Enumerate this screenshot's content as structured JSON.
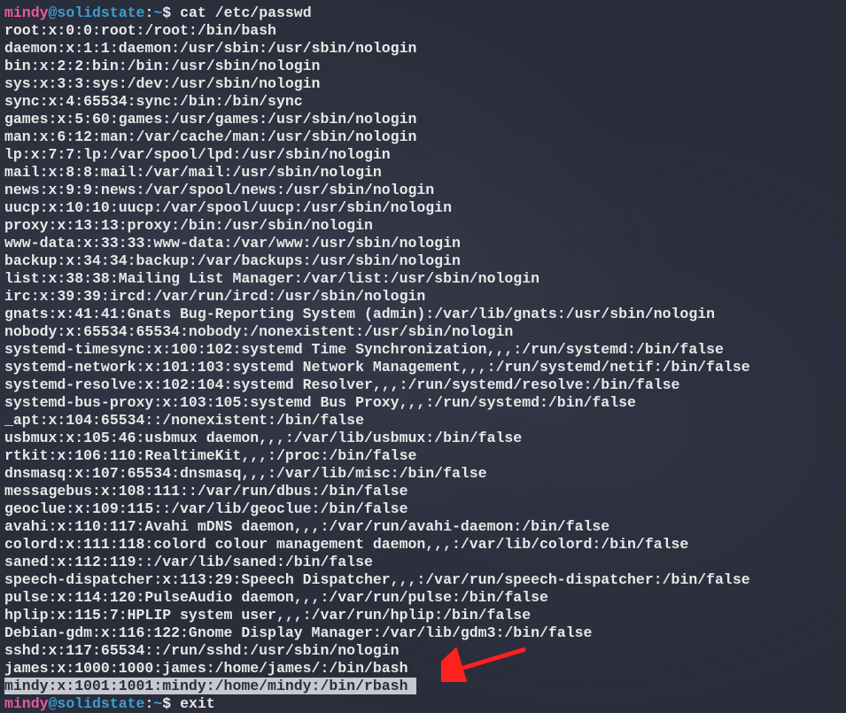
{
  "prompt1": {
    "user": "mindy",
    "at": "@",
    "host": "solidstate",
    "colon": ":",
    "path": "~",
    "dollar": "$ ",
    "command": "cat /etc/passwd"
  },
  "output": {
    "lines": [
      "root:x:0:0:root:/root:/bin/bash",
      "daemon:x:1:1:daemon:/usr/sbin:/usr/sbin/nologin",
      "bin:x:2:2:bin:/bin:/usr/sbin/nologin",
      "sys:x:3:3:sys:/dev:/usr/sbin/nologin",
      "sync:x:4:65534:sync:/bin:/bin/sync",
      "games:x:5:60:games:/usr/games:/usr/sbin/nologin",
      "man:x:6:12:man:/var/cache/man:/usr/sbin/nologin",
      "lp:x:7:7:lp:/var/spool/lpd:/usr/sbin/nologin",
      "mail:x:8:8:mail:/var/mail:/usr/sbin/nologin",
      "news:x:9:9:news:/var/spool/news:/usr/sbin/nologin",
      "uucp:x:10:10:uucp:/var/spool/uucp:/usr/sbin/nologin",
      "proxy:x:13:13:proxy:/bin:/usr/sbin/nologin",
      "www-data:x:33:33:www-data:/var/www:/usr/sbin/nologin",
      "backup:x:34:34:backup:/var/backups:/usr/sbin/nologin",
      "list:x:38:38:Mailing List Manager:/var/list:/usr/sbin/nologin",
      "irc:x:39:39:ircd:/var/run/ircd:/usr/sbin/nologin",
      "gnats:x:41:41:Gnats Bug-Reporting System (admin):/var/lib/gnats:/usr/sbin/nologin",
      "nobody:x:65534:65534:nobody:/nonexistent:/usr/sbin/nologin",
      "systemd-timesync:x:100:102:systemd Time Synchronization,,,:/run/systemd:/bin/false",
      "systemd-network:x:101:103:systemd Network Management,,,:/run/systemd/netif:/bin/false",
      "systemd-resolve:x:102:104:systemd Resolver,,,:/run/systemd/resolve:/bin/false",
      "systemd-bus-proxy:x:103:105:systemd Bus Proxy,,,:/run/systemd:/bin/false",
      "_apt:x:104:65534::/nonexistent:/bin/false",
      "usbmux:x:105:46:usbmux daemon,,,:/var/lib/usbmux:/bin/false",
      "rtkit:x:106:110:RealtimeKit,,,:/proc:/bin/false",
      "dnsmasq:x:107:65534:dnsmasq,,,:/var/lib/misc:/bin/false",
      "messagebus:x:108:111::/var/run/dbus:/bin/false",
      "geoclue:x:109:115::/var/lib/geoclue:/bin/false",
      "avahi:x:110:117:Avahi mDNS daemon,,,:/var/run/avahi-daemon:/bin/false",
      "colord:x:111:118:colord colour management daemon,,,:/var/lib/colord:/bin/false",
      "saned:x:112:119::/var/lib/saned:/bin/false",
      "speech-dispatcher:x:113:29:Speech Dispatcher,,,:/var/run/speech-dispatcher:/bin/false",
      "pulse:x:114:120:PulseAudio daemon,,,:/var/run/pulse:/bin/false",
      "hplip:x:115:7:HPLIP system user,,,:/var/run/hplip:/bin/false",
      "Debian-gdm:x:116:122:Gnome Display Manager:/var/lib/gdm3:/bin/false",
      "sshd:x:117:65534::/run/sshd:/usr/sbin/nologin",
      "james:x:1000:1000:james:/home/james/:/bin/bash"
    ],
    "highlighted": "mindy:x:1001:1001:mindy:/home/mindy:/bin/rbash "
  },
  "prompt2": {
    "user": "mindy",
    "at": "@",
    "host": "solidstate",
    "colon": ":",
    "path": "~",
    "dollar": "$ ",
    "command": "exit"
  }
}
